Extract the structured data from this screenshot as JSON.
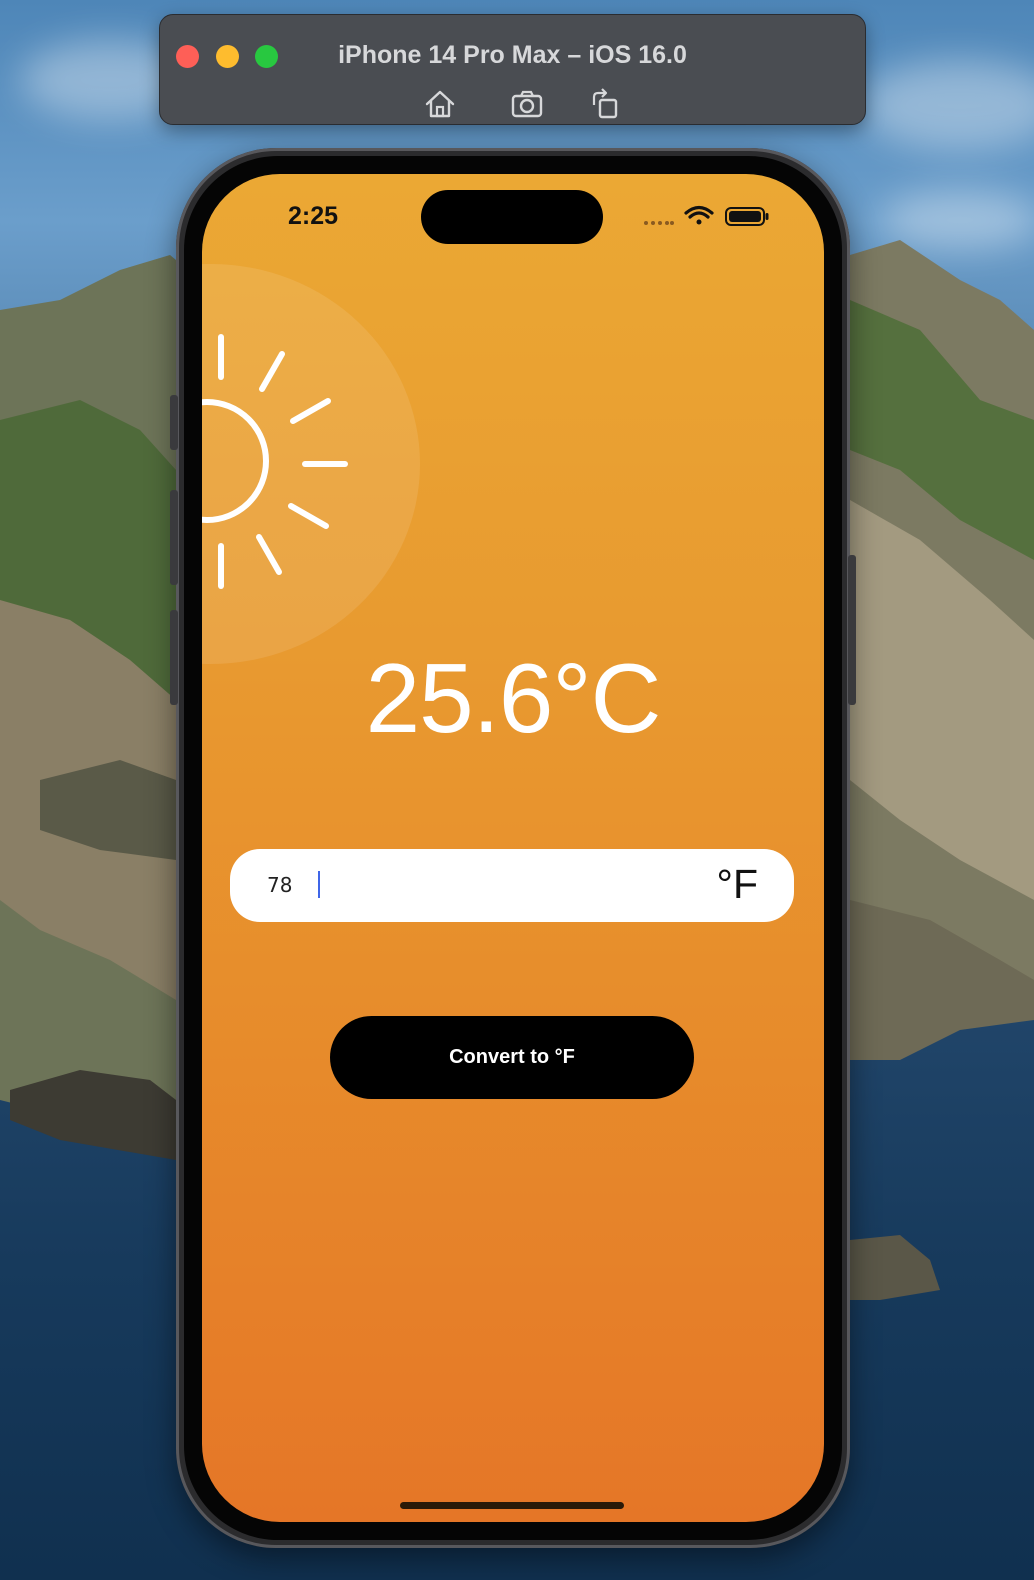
{
  "simulator": {
    "title": "iPhone 14 Pro Max – iOS 16.0",
    "toolbar": [
      {
        "icon": "home-icon"
      },
      {
        "icon": "screenshot-icon"
      },
      {
        "icon": "rotate-icon"
      }
    ]
  },
  "status_bar": {
    "time": "2:25",
    "icons": [
      "signal-icon",
      "wifi-icon",
      "battery-icon"
    ]
  },
  "app": {
    "weather_icon": "sun-icon",
    "temperature_display": "25.6°C",
    "input": {
      "value": "78",
      "unit_label": "°F"
    },
    "convert_button_label": "Convert to °F"
  },
  "colors": {
    "gradient_top": "#eba834",
    "gradient_bottom": "#e57627",
    "button_bg": "#000000",
    "caret": "#3f66e8"
  }
}
